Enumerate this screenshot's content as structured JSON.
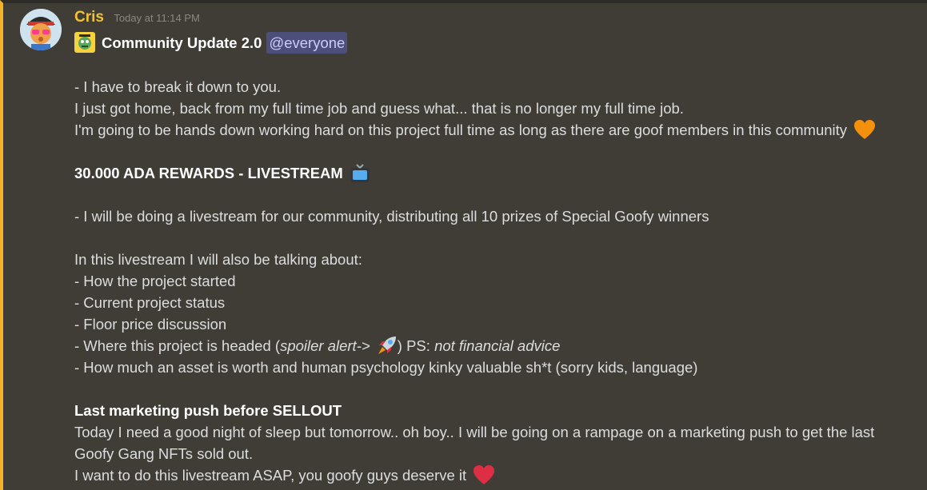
{
  "message": {
    "author": "Cris",
    "timestamp": "Today at 11:14 PM",
    "title": "Community Update 2.0",
    "mention": "@everyone",
    "lines": {
      "l1": "- I have to break it down to you.",
      "l2": "I just got home, back from my full time job and guess what... that is no longer my full time job.",
      "l3": "I'm going to be hands down working hard on this project full time as long as there are goof members in this community",
      "l4": "30.000 ADA REWARDS - LIVESTREAM",
      "l5": "- I will be doing a livestream for our community, distributing all 10 prizes of Special Goofy winners",
      "l6": "In this livestream I will also be talking about:",
      "l7": "- How the project started",
      "l8": "- Current project status",
      "l9": "- Floor price discussion",
      "l10_pre": "- Where this project is headed (",
      "l10_spoiler": "spoiler alert->",
      "l10_mid": ") PS:",
      "l10_advice": "not financial advice",
      "l11": "- How much an asset is worth and human psychology kinky valuable sh*t (sorry kids, language)",
      "l12": "Last marketing push before SELLOUT",
      "l13": "Today I need a good night of sleep but tomorrow.. oh boy.. I will be going on a rampage on a marketing push to get the last",
      "l14": "Goofy Gang NFTs sold out.",
      "l15": "I want to do this livestream ASAP, you goofy guys deserve it"
    },
    "emojis": {
      "title": "goofy-custom-emoji",
      "l3": "orange-heart",
      "l4": "television",
      "l10": "rocket",
      "l15": "red-heart"
    }
  },
  "colors": {
    "background": "#403d36",
    "accent_bar": "#f2b427",
    "author": "#f3c233",
    "mention_bg": "#4c4f7a",
    "text": "#dcddde"
  }
}
